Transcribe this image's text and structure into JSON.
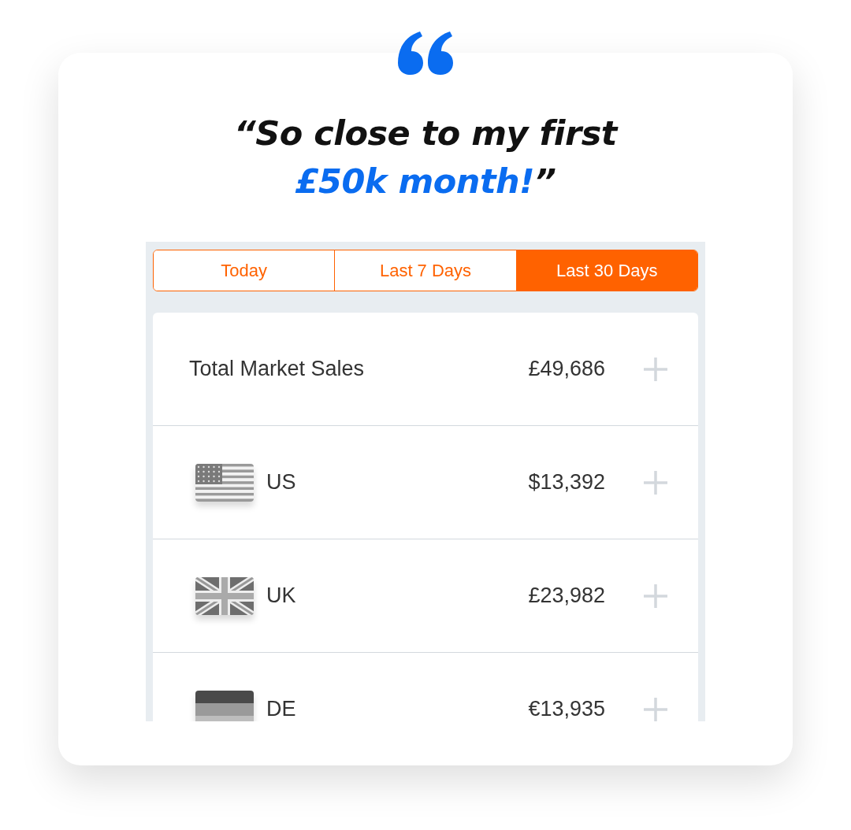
{
  "testimonial": {
    "opening": "“So close to my first",
    "highlight": "£50k month!",
    "closing": "”"
  },
  "tabs": [
    {
      "label": "Today",
      "selected": false
    },
    {
      "label": "Last 7 Days",
      "selected": false
    },
    {
      "label": "Last 30 Days",
      "selected": true
    }
  ],
  "rows": [
    {
      "kind": "total",
      "label": "Total Market Sales",
      "value": "£49,686"
    },
    {
      "kind": "us",
      "label": "US",
      "value": "$13,392"
    },
    {
      "kind": "uk",
      "label": "UK",
      "value": "£23,982"
    },
    {
      "kind": "de",
      "label": "DE",
      "value": "€13,935"
    }
  ]
}
